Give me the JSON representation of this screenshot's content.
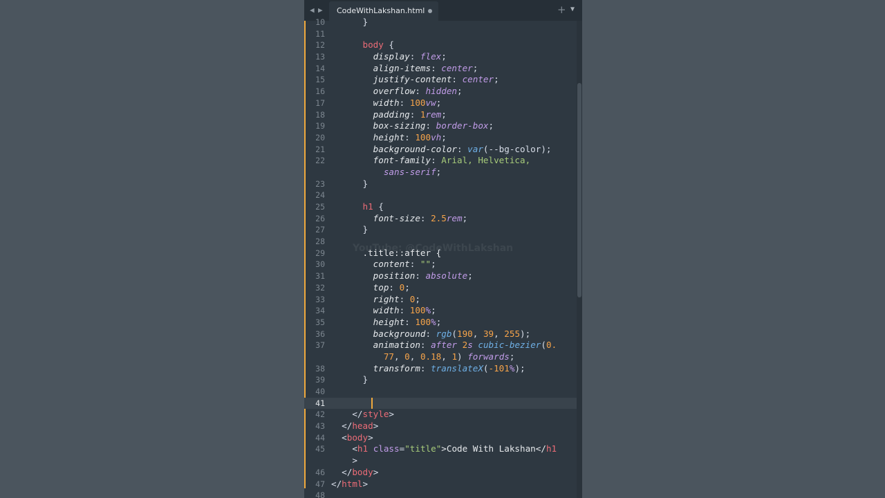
{
  "tab": {
    "back_icon": "◀",
    "forward_icon": "▶",
    "filename": "CodeWithLakshan.html",
    "new_tab_icon": "+",
    "menu_icon": "▼"
  },
  "watermark": "YouTube: @CodeWithLakshan",
  "lines": [
    {
      "n": "10",
      "tokens": [
        {
          "t": "      }",
          "c": "punc"
        }
      ]
    },
    {
      "n": "11",
      "tokens": []
    },
    {
      "n": "12",
      "tokens": [
        {
          "t": "      ",
          "c": "punc"
        },
        {
          "t": "body",
          "c": "sel"
        },
        {
          "t": " {",
          "c": "punc"
        }
      ]
    },
    {
      "n": "13",
      "tokens": [
        {
          "t": "        ",
          "c": "punc"
        },
        {
          "t": "display",
          "c": "prop"
        },
        {
          "t": ": ",
          "c": "punc"
        },
        {
          "t": "flex",
          "c": "val"
        },
        {
          "t": ";",
          "c": "punc"
        }
      ]
    },
    {
      "n": "14",
      "tokens": [
        {
          "t": "        ",
          "c": "punc"
        },
        {
          "t": "align-items",
          "c": "prop"
        },
        {
          "t": ": ",
          "c": "punc"
        },
        {
          "t": "center",
          "c": "val"
        },
        {
          "t": ";",
          "c": "punc"
        }
      ]
    },
    {
      "n": "15",
      "tokens": [
        {
          "t": "        ",
          "c": "punc"
        },
        {
          "t": "justify-content",
          "c": "prop"
        },
        {
          "t": ": ",
          "c": "punc"
        },
        {
          "t": "center",
          "c": "val"
        },
        {
          "t": ";",
          "c": "punc"
        }
      ]
    },
    {
      "n": "16",
      "tokens": [
        {
          "t": "        ",
          "c": "punc"
        },
        {
          "t": "overflow",
          "c": "prop"
        },
        {
          "t": ": ",
          "c": "punc"
        },
        {
          "t": "hidden",
          "c": "val"
        },
        {
          "t": ";",
          "c": "punc"
        }
      ]
    },
    {
      "n": "17",
      "tokens": [
        {
          "t": "        ",
          "c": "punc"
        },
        {
          "t": "width",
          "c": "prop"
        },
        {
          "t": ": ",
          "c": "punc"
        },
        {
          "t": "100",
          "c": "num"
        },
        {
          "t": "vw",
          "c": "unit"
        },
        {
          "t": ";",
          "c": "punc"
        }
      ]
    },
    {
      "n": "18",
      "tokens": [
        {
          "t": "        ",
          "c": "punc"
        },
        {
          "t": "padding",
          "c": "prop"
        },
        {
          "t": ": ",
          "c": "punc"
        },
        {
          "t": "1",
          "c": "num"
        },
        {
          "t": "rem",
          "c": "unit"
        },
        {
          "t": ";",
          "c": "punc"
        }
      ]
    },
    {
      "n": "19",
      "tokens": [
        {
          "t": "        ",
          "c": "punc"
        },
        {
          "t": "box-sizing",
          "c": "prop"
        },
        {
          "t": ": ",
          "c": "punc"
        },
        {
          "t": "border-box",
          "c": "val"
        },
        {
          "t": ";",
          "c": "punc"
        }
      ]
    },
    {
      "n": "20",
      "tokens": [
        {
          "t": "        ",
          "c": "punc"
        },
        {
          "t": "height",
          "c": "prop"
        },
        {
          "t": ": ",
          "c": "punc"
        },
        {
          "t": "100",
          "c": "num"
        },
        {
          "t": "vh",
          "c": "unit"
        },
        {
          "t": ";",
          "c": "punc"
        }
      ]
    },
    {
      "n": "21",
      "tokens": [
        {
          "t": "        ",
          "c": "punc"
        },
        {
          "t": "background-color",
          "c": "prop"
        },
        {
          "t": ": ",
          "c": "punc"
        },
        {
          "t": "var",
          "c": "fn"
        },
        {
          "t": "(--bg-color);",
          "c": "punc"
        }
      ]
    },
    {
      "n": "22",
      "tokens": [
        {
          "t": "        ",
          "c": "punc"
        },
        {
          "t": "font-family",
          "c": "prop"
        },
        {
          "t": ": ",
          "c": "punc"
        },
        {
          "t": "Arial, Helvetica,",
          "c": "str"
        }
      ]
    },
    {
      "n": "",
      "tokens": [
        {
          "t": "          ",
          "c": "punc"
        },
        {
          "t": "sans-serif",
          "c": "val"
        },
        {
          "t": ";",
          "c": "punc"
        }
      ]
    },
    {
      "n": "23",
      "tokens": [
        {
          "t": "      }",
          "c": "punc"
        }
      ]
    },
    {
      "n": "24",
      "tokens": []
    },
    {
      "n": "25",
      "tokens": [
        {
          "t": "      ",
          "c": "punc"
        },
        {
          "t": "h1",
          "c": "sel"
        },
        {
          "t": " {",
          "c": "punc"
        }
      ]
    },
    {
      "n": "26",
      "tokens": [
        {
          "t": "        ",
          "c": "punc"
        },
        {
          "t": "font-size",
          "c": "prop"
        },
        {
          "t": ": ",
          "c": "punc"
        },
        {
          "t": "2.5",
          "c": "num"
        },
        {
          "t": "rem",
          "c": "unit"
        },
        {
          "t": ";",
          "c": "punc"
        }
      ]
    },
    {
      "n": "27",
      "tokens": [
        {
          "t": "      }",
          "c": "punc"
        }
      ]
    },
    {
      "n": "28",
      "tokens": []
    },
    {
      "n": "29",
      "tokens": [
        {
          "t": "      .title::after {",
          "c": "text"
        }
      ]
    },
    {
      "n": "30",
      "tokens": [
        {
          "t": "        ",
          "c": "punc"
        },
        {
          "t": "content",
          "c": "prop"
        },
        {
          "t": ": ",
          "c": "punc"
        },
        {
          "t": "\"\"",
          "c": "str"
        },
        {
          "t": ";",
          "c": "punc"
        }
      ]
    },
    {
      "n": "31",
      "tokens": [
        {
          "t": "        ",
          "c": "punc"
        },
        {
          "t": "position",
          "c": "prop"
        },
        {
          "t": ": ",
          "c": "punc"
        },
        {
          "t": "absolute",
          "c": "val"
        },
        {
          "t": ";",
          "c": "punc"
        }
      ]
    },
    {
      "n": "32",
      "tokens": [
        {
          "t": "        ",
          "c": "punc"
        },
        {
          "t": "top",
          "c": "prop"
        },
        {
          "t": ": ",
          "c": "punc"
        },
        {
          "t": "0",
          "c": "num"
        },
        {
          "t": ";",
          "c": "punc"
        }
      ]
    },
    {
      "n": "33",
      "tokens": [
        {
          "t": "        ",
          "c": "punc"
        },
        {
          "t": "right",
          "c": "prop"
        },
        {
          "t": ": ",
          "c": "punc"
        },
        {
          "t": "0",
          "c": "num"
        },
        {
          "t": ";",
          "c": "punc"
        }
      ]
    },
    {
      "n": "34",
      "tokens": [
        {
          "t": "        ",
          "c": "punc"
        },
        {
          "t": "width",
          "c": "prop"
        },
        {
          "t": ": ",
          "c": "punc"
        },
        {
          "t": "100",
          "c": "num"
        },
        {
          "t": "%",
          "c": "unit"
        },
        {
          "t": ";",
          "c": "punc"
        }
      ]
    },
    {
      "n": "35",
      "tokens": [
        {
          "t": "        ",
          "c": "punc"
        },
        {
          "t": "height",
          "c": "prop"
        },
        {
          "t": ": ",
          "c": "punc"
        },
        {
          "t": "100",
          "c": "num"
        },
        {
          "t": "%",
          "c": "unit"
        },
        {
          "t": ";",
          "c": "punc"
        }
      ]
    },
    {
      "n": "36",
      "tokens": [
        {
          "t": "        ",
          "c": "punc"
        },
        {
          "t": "background",
          "c": "prop"
        },
        {
          "t": ": ",
          "c": "punc"
        },
        {
          "t": "rgb",
          "c": "fn"
        },
        {
          "t": "(",
          "c": "punc"
        },
        {
          "t": "190",
          "c": "num"
        },
        {
          "t": ", ",
          "c": "punc"
        },
        {
          "t": "39",
          "c": "num"
        },
        {
          "t": ", ",
          "c": "punc"
        },
        {
          "t": "255",
          "c": "num"
        },
        {
          "t": ");",
          "c": "punc"
        }
      ]
    },
    {
      "n": "37",
      "tokens": [
        {
          "t": "        ",
          "c": "punc"
        },
        {
          "t": "animation",
          "c": "prop"
        },
        {
          "t": ": ",
          "c": "punc"
        },
        {
          "t": "after",
          "c": "val"
        },
        {
          "t": " ",
          "c": "punc"
        },
        {
          "t": "2",
          "c": "num"
        },
        {
          "t": "s",
          "c": "unit"
        },
        {
          "t": " ",
          "c": "punc"
        },
        {
          "t": "cubic-bezier",
          "c": "fn"
        },
        {
          "t": "(",
          "c": "punc"
        },
        {
          "t": "0.",
          "c": "num"
        }
      ]
    },
    {
      "n": "",
      "tokens": [
        {
          "t": "          ",
          "c": "punc"
        },
        {
          "t": "77",
          "c": "num"
        },
        {
          "t": ", ",
          "c": "punc"
        },
        {
          "t": "0",
          "c": "num"
        },
        {
          "t": ", ",
          "c": "punc"
        },
        {
          "t": "0.18",
          "c": "num"
        },
        {
          "t": ", ",
          "c": "punc"
        },
        {
          "t": "1",
          "c": "num"
        },
        {
          "t": ") ",
          "c": "punc"
        },
        {
          "t": "forwards",
          "c": "val"
        },
        {
          "t": ";",
          "c": "punc"
        }
      ]
    },
    {
      "n": "38",
      "tokens": [
        {
          "t": "        ",
          "c": "punc"
        },
        {
          "t": "transform",
          "c": "prop"
        },
        {
          "t": ": ",
          "c": "punc"
        },
        {
          "t": "translateX",
          "c": "fn"
        },
        {
          "t": "(",
          "c": "punc"
        },
        {
          "t": "-101",
          "c": "num"
        },
        {
          "t": "%",
          "c": "unit"
        },
        {
          "t": ");",
          "c": "punc"
        }
      ]
    },
    {
      "n": "39",
      "tokens": [
        {
          "t": "      }",
          "c": "punc"
        }
      ]
    },
    {
      "n": "40",
      "tokens": []
    },
    {
      "n": "41",
      "tokens": [],
      "active": true
    },
    {
      "n": "42",
      "tokens": [
        {
          "t": "    </",
          "c": "punc"
        },
        {
          "t": "style",
          "c": "tag"
        },
        {
          "t": ">",
          "c": "punc"
        }
      ]
    },
    {
      "n": "43",
      "tokens": [
        {
          "t": "  </",
          "c": "punc"
        },
        {
          "t": "head",
          "c": "tag"
        },
        {
          "t": ">",
          "c": "punc"
        }
      ]
    },
    {
      "n": "44",
      "tokens": [
        {
          "t": "  <",
          "c": "punc"
        },
        {
          "t": "body",
          "c": "tag"
        },
        {
          "t": ">",
          "c": "punc"
        }
      ]
    },
    {
      "n": "45",
      "tokens": [
        {
          "t": "    <",
          "c": "punc"
        },
        {
          "t": "h1",
          "c": "tag"
        },
        {
          "t": " ",
          "c": "punc"
        },
        {
          "t": "class",
          "c": "attr"
        },
        {
          "t": "=",
          "c": "punc"
        },
        {
          "t": "\"title\"",
          "c": "str"
        },
        {
          "t": ">Code With Lakshan</",
          "c": "text"
        },
        {
          "t": "h1",
          "c": "tag"
        }
      ]
    },
    {
      "n": "",
      "tokens": [
        {
          "t": "    >",
          "c": "punc"
        }
      ]
    },
    {
      "n": "46",
      "tokens": [
        {
          "t": "  </",
          "c": "punc"
        },
        {
          "t": "body",
          "c": "tag"
        },
        {
          "t": ">",
          "c": "punc"
        }
      ]
    },
    {
      "n": "47",
      "tokens": [
        {
          "t": "</",
          "c": "punc"
        },
        {
          "t": "html",
          "c": "tag"
        },
        {
          "t": ">",
          "c": "punc"
        }
      ]
    },
    {
      "n": "48",
      "tokens": []
    }
  ],
  "colors": {
    "background": "#4b555e",
    "editor_bg": "#2e3841",
    "gutter_marker": "#f0a93c",
    "selector": "#ec6c77",
    "value": "#c19ce8",
    "number": "#f7a44a",
    "string": "#a7cb7a",
    "function": "#6fb0e6"
  }
}
